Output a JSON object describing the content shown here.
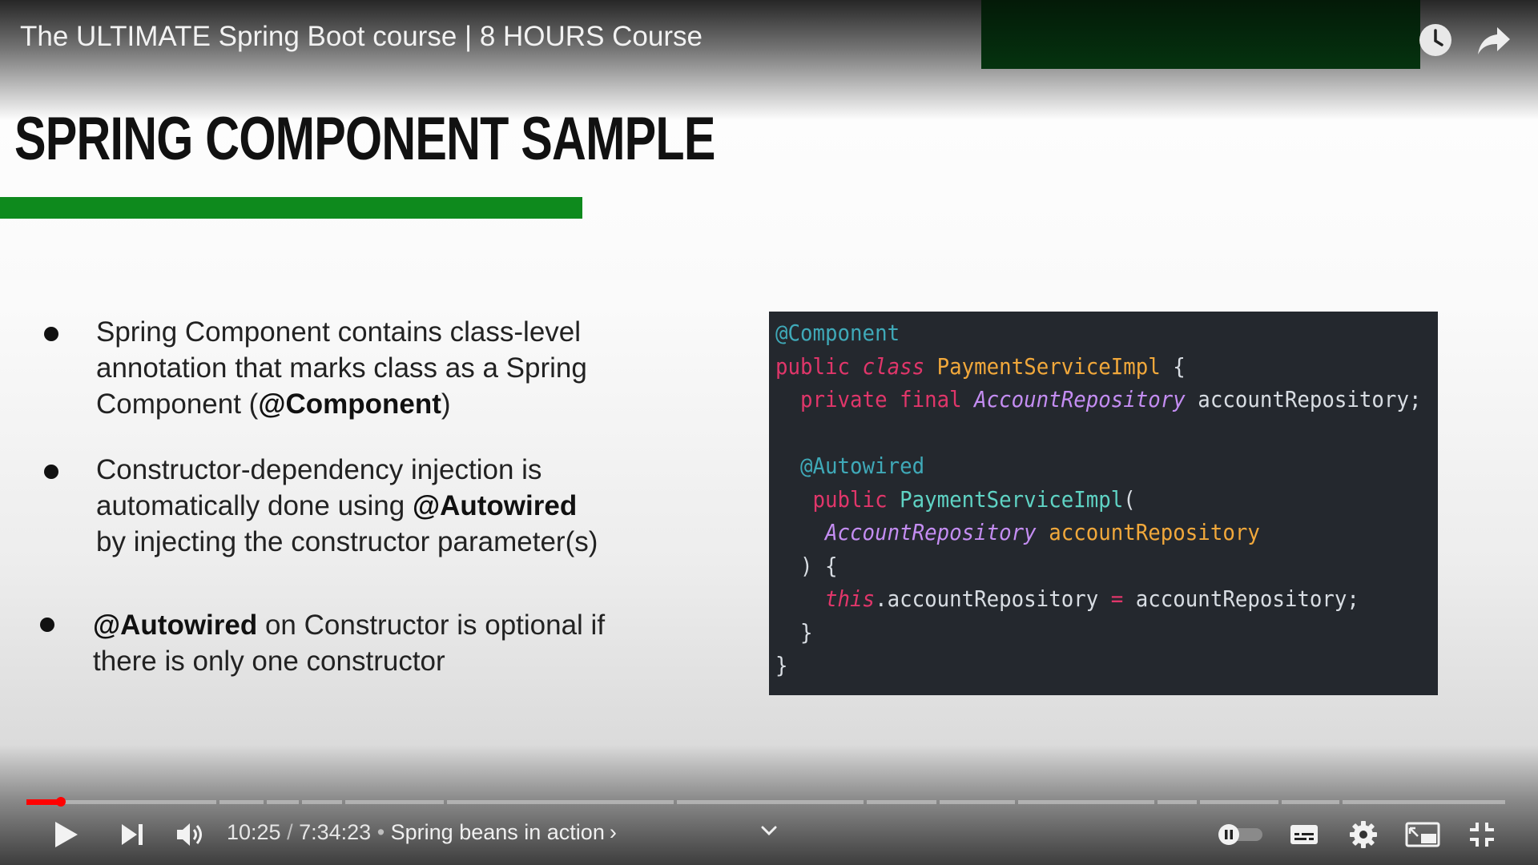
{
  "video": {
    "title": "The ULTIMATE Spring Boot course | 8 HOURS Course"
  },
  "top_actions": [
    {
      "name": "watch-later",
      "icon": "clock-icon"
    },
    {
      "name": "share",
      "icon": "share-arrow-icon"
    }
  ],
  "slide": {
    "heading": "Spring Component Sample",
    "accent_color": "#0e8a1d",
    "bullets": [
      {
        "lines": [
          [
            {
              "t": "Spring Component contains class-level",
              "b": false
            }
          ],
          [
            {
              "t": "annotation that marks class as a Spring",
              "b": false
            }
          ],
          [
            {
              "t": "Component (",
              "b": false
            },
            {
              "t": "@Component",
              "b": true
            },
            {
              "t": ")",
              "b": false
            }
          ]
        ]
      },
      {
        "lines": [
          [
            {
              "t": "Constructor-dependency injection is",
              "b": false
            }
          ],
          [
            {
              "t": "automatically done using ",
              "b": false
            },
            {
              "t": "@Autowired",
              "b": true
            }
          ],
          [
            {
              "t": "by injecting the constructor parameter(s)",
              "b": false
            }
          ]
        ]
      },
      {
        "lines": [
          [
            {
              "t": "@Autowired",
              "b": true
            },
            {
              "t": " on Constructor is optional if",
              "b": false
            }
          ],
          [
            {
              "t": "there is only one constructor",
              "b": false
            }
          ]
        ]
      }
    ],
    "code": [
      [
        {
          "t": "@Component",
          "c": "ann"
        }
      ],
      [
        {
          "t": "public ",
          "c": "kw"
        },
        {
          "t": "class ",
          "c": "kwi"
        },
        {
          "t": "PaymentServiceImpl ",
          "c": "type"
        },
        {
          "t": "{",
          "c": "plain"
        }
      ],
      [
        {
          "t": "  private final ",
          "c": "kw"
        },
        {
          "t": "AccountRepository ",
          "c": "typei"
        },
        {
          "t": "accountRepository;",
          "c": "plain"
        }
      ],
      [
        {
          "t": "",
          "c": "plain"
        }
      ],
      [
        {
          "t": "  @Autowired",
          "c": "ann"
        }
      ],
      [
        {
          "t": "   public ",
          "c": "kw"
        },
        {
          "t": "PaymentServiceImpl",
          "c": "fn"
        },
        {
          "t": "(",
          "c": "plain"
        }
      ],
      [
        {
          "t": "    AccountRepository ",
          "c": "typei"
        },
        {
          "t": "accountRepository",
          "c": "var"
        }
      ],
      [
        {
          "t": "  ) {",
          "c": "plain"
        }
      ],
      [
        {
          "t": "    this",
          "c": "kwi"
        },
        {
          "t": ".accountRepository ",
          "c": "plain"
        },
        {
          "t": "= ",
          "c": "kw"
        },
        {
          "t": "accountRepository;",
          "c": "plain"
        }
      ],
      [
        {
          "t": "  }",
          "c": "plain"
        }
      ],
      [
        {
          "t": "}",
          "c": "plain"
        }
      ]
    ]
  },
  "player": {
    "current_time": "10:25",
    "separator": " / ",
    "duration": "7:34:23",
    "bullet_sep": " • ",
    "chapter": "Spring beans in action",
    "chapter_chevron": "›",
    "progress_fraction": 0.023,
    "progress_color": "#ff0000",
    "chapter_markers": [
      0.13,
      0.162,
      0.186,
      0.215,
      0.284,
      0.439,
      0.567,
      0.616,
      0.669,
      0.763,
      0.792,
      0.847,
      0.888
    ],
    "autoplay": "off",
    "controls": [
      {
        "name": "play-button",
        "icon": "play-icon"
      },
      {
        "name": "next-button",
        "icon": "skip-next-icon"
      },
      {
        "name": "volume-button",
        "icon": "volume-icon"
      },
      {
        "name": "autoplay-toggle",
        "icon": "pause-toggle-icon"
      },
      {
        "name": "subtitles-button",
        "icon": "subtitles-icon"
      },
      {
        "name": "settings-button",
        "icon": "gear-icon"
      },
      {
        "name": "miniplayer-button",
        "icon": "miniplayer-icon"
      },
      {
        "name": "exit-fullscreen-button",
        "icon": "exit-fullscreen-icon"
      }
    ]
  }
}
